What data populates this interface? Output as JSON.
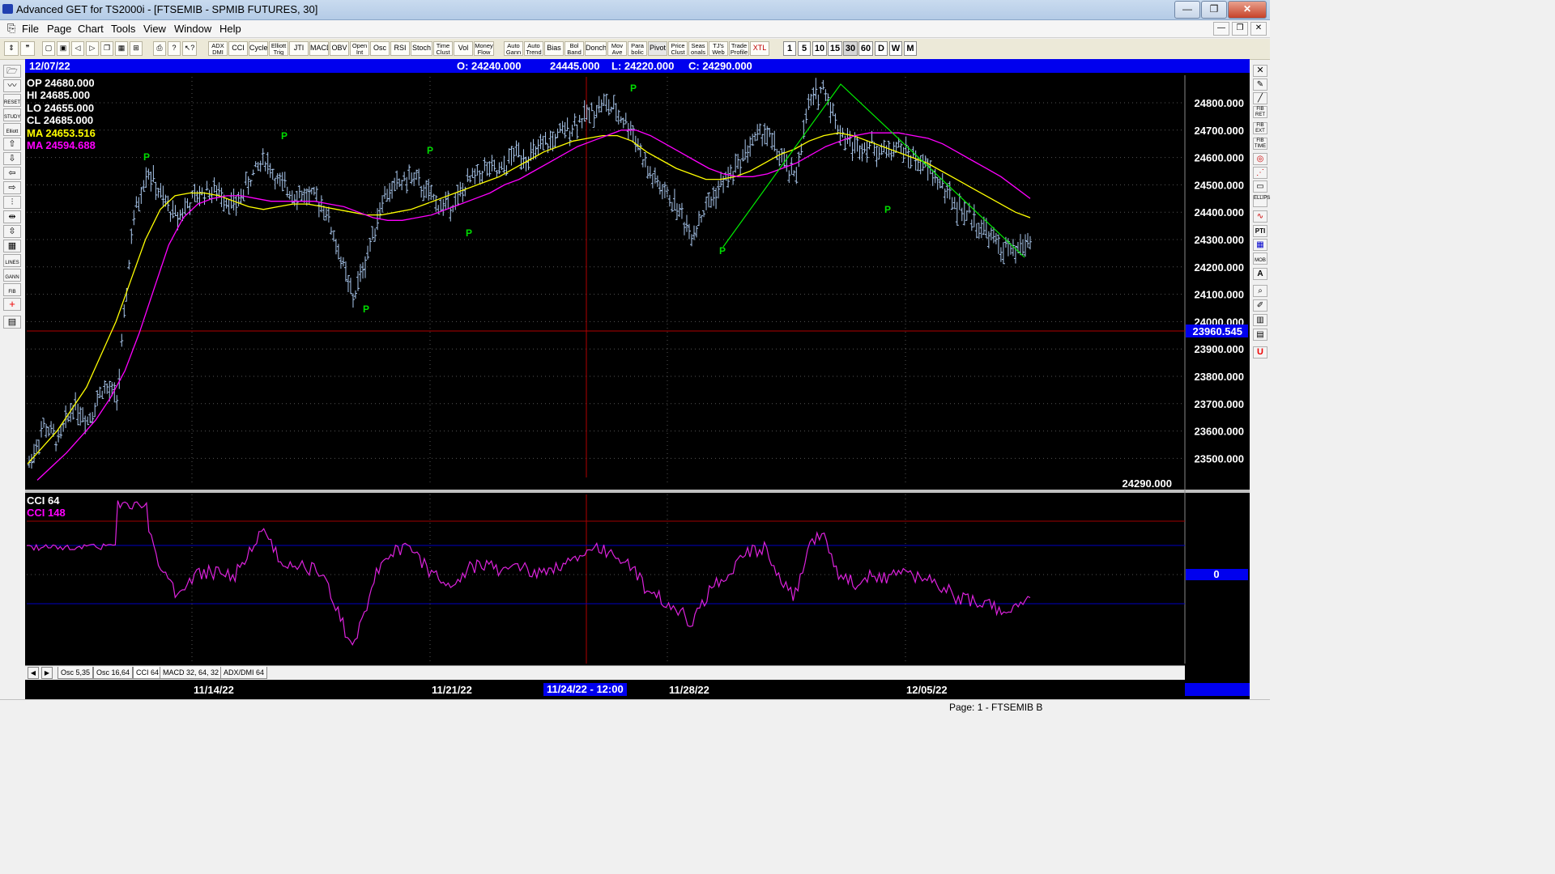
{
  "window": {
    "title": "Advanced GET for TS2000i - [FTSEMIB - SPMIB FUTURES, 30]",
    "minimize": "—",
    "restore": "❐",
    "close": "✕"
  },
  "menu": [
    "File",
    "Page",
    "Chart",
    "Tools",
    "View",
    "Window",
    "Help"
  ],
  "toolbar": {
    "buttons": [
      "ADX DMI",
      "CCI",
      "Cycles",
      "Elliott Trig",
      "JTI",
      "MACD",
      "OBV",
      "Open Int",
      "Osc",
      "RSI",
      "Stoch",
      "Time Clust",
      "Vol",
      "Money Flow",
      "Auto Gann",
      "Auto Trend",
      "Bias",
      "Bol Band",
      "Donch",
      "Mov Ave",
      "Para bolic",
      "Pivot",
      "Price Clust",
      "Seas onals",
      "TJ's Web",
      "Trade Profile",
      "XTL"
    ],
    "timeframes": [
      "1",
      "5",
      "10",
      "15",
      "30",
      "60",
      "D",
      "W",
      "M"
    ],
    "selected_timeframe": "30"
  },
  "left_tools": [
    "RESET",
    "STUDY",
    "Elliott",
    "LINES",
    "GANN",
    "FIB"
  ],
  "right_tools": [
    "FIB RET",
    "FIB EXT",
    "FIB TIME",
    "ELLIPS",
    "PTI",
    "MOB",
    "A",
    "U"
  ],
  "header": {
    "date": "12/07/22",
    "open": "O: 24240.000",
    "high": "24445.000",
    "low": "L: 24220.000",
    "close": "C: 24290.000"
  },
  "info": {
    "op": "OP  24680.000",
    "hi": "HI   24685.000",
    "lo": "LO   24655.000",
    "cl": "CL   24685.000",
    "ma1": "MA  24653.516",
    "ma2": "MA  24594.688"
  },
  "price_panel": {
    "last_price": "24290.000",
    "cursor_price": "23960.545",
    "axis_labels": [
      "24800.000",
      "24700.000",
      "24600.000",
      "24500.000",
      "24400.000",
      "24300.000",
      "24200.000",
      "24100.000",
      "24000.000",
      "23900.000",
      "23800.000",
      "23700.000",
      "23600.000",
      "23500.000"
    ]
  },
  "cci_panel": {
    "name": "CCI 64",
    "value": "CCI  148",
    "zero_label": "0"
  },
  "tabs": [
    "Osc 5,35",
    "Osc 16,64",
    "CCI 64",
    "MACD 32, 64, 32",
    "ADX/DMI 64"
  ],
  "tab_arrows": [
    "◀",
    "▶"
  ],
  "time_axis": {
    "labels": [
      "11/14/22",
      "11/21/22",
      "11/28/22",
      "12/05/22"
    ],
    "cursor_label": "11/24/22 - 12:00"
  },
  "pivot_label": "P",
  "status": "Page: 1 - FTSEMIB B",
  "colors": {
    "ma_fast": "#ffff00",
    "ma_slow": "#ff00ff",
    "pivot": "#00dd00",
    "header_bar": "#0000ee"
  },
  "chart_data": {
    "type": "line",
    "symbol": "FTSEMIB - SPMIB FUTURES, 30",
    "ylim": [
      23450,
      24850
    ],
    "series": [
      {
        "name": "Price",
        "values": [
          23480,
          23620,
          23560,
          23700,
          23640,
          23760,
          23720,
          24350,
          24560,
          24450,
          24380,
          24440,
          24480,
          24470,
          24420,
          24520,
          24600,
          24500,
          24470,
          24460,
          24430,
          24260,
          24080,
          24250,
          24450,
          24500,
          24530,
          24470,
          24420,
          24440,
          24520,
          24560,
          24540,
          24620,
          24600,
          24640,
          24680,
          24720,
          24760,
          24800,
          24760,
          24700,
          24550,
          24480,
          24420,
          24320,
          24420,
          24500,
          24560,
          24650,
          24700,
          24600,
          24520,
          24800,
          24860,
          24700,
          24640,
          24650,
          24620,
          24640,
          24600,
          24560,
          24500,
          24420,
          24380,
          24330,
          24270,
          24250,
          24300
        ]
      },
      {
        "name": "MA",
        "values": [
          23480,
          23540,
          23600,
          23680,
          23760,
          23880,
          24000,
          24150,
          24300,
          24410,
          24460,
          24470,
          24470,
          24460,
          24440,
          24420,
          24410,
          24420,
          24430,
          24430,
          24420,
          24410,
          24400,
          24390,
          24390,
          24400,
          24410,
          24430,
          24450,
          24470,
          24490,
          24510,
          24530,
          24560,
          24590,
          24620,
          24640,
          24660,
          24670,
          24680,
          24680,
          24660,
          24620,
          24590,
          24560,
          24540,
          24520,
          24520,
          24530,
          24550,
          24580,
          24610,
          24630,
          24660,
          24680,
          24690,
          24680,
          24660,
          24640,
          24620,
          24600,
          24580,
          24550,
          24520,
          24490,
          24460,
          24430,
          24400,
          24380
        ]
      },
      {
        "name": "MA",
        "values": [
          23420,
          23470,
          23520,
          23580,
          23640,
          23720,
          23820,
          23960,
          24120,
          24280,
          24380,
          24430,
          24450,
          24460,
          24460,
          24450,
          24440,
          24440,
          24440,
          24440,
          24430,
          24420,
          24400,
          24380,
          24370,
          24370,
          24380,
          24390,
          24410,
          24430,
          24450,
          24470,
          24500,
          24520,
          24550,
          24580,
          24610,
          24640,
          24660,
          24680,
          24700,
          24700,
          24680,
          24650,
          24620,
          24590,
          24560,
          24540,
          24530,
          24530,
          24540,
          24560,
          24580,
          24610,
          24640,
          24660,
          24680,
          24690,
          24690,
          24690,
          24680,
          24670,
          24650,
          24620,
          24590,
          24560,
          24530,
          24490,
          24450
        ]
      }
    ]
  }
}
